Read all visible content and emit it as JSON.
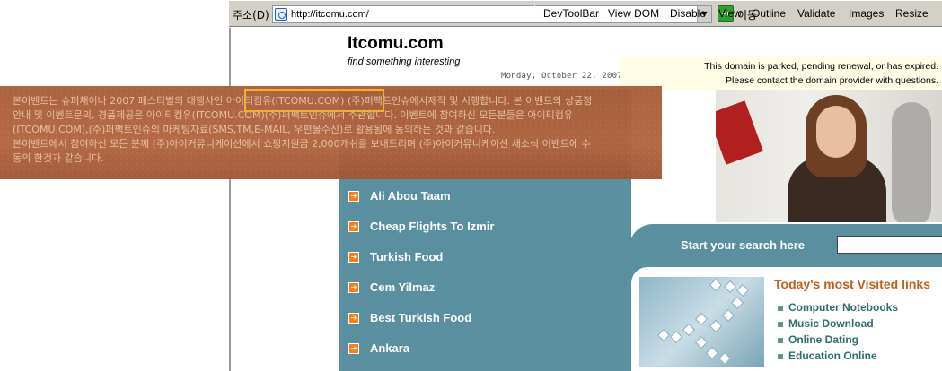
{
  "browser": {
    "address_label": "주소(D)",
    "url": "http://itcomu.com/",
    "go_label": "이동",
    "toolbar": [
      "DevToolBar",
      "View DOM",
      "Disable",
      "View",
      "Outline",
      "Validate",
      "Images",
      "Resize"
    ]
  },
  "site": {
    "title": "Itcomu.com",
    "tagline": "find something interesting",
    "date": "Monday, October 22, 2007"
  },
  "notice": {
    "line1": "This domain is parked, pending renewal, or has expired.",
    "line2": "Please contact the domain provider with questions."
  },
  "overlay": {
    "lines": [
      "본이벤트는 슈퍼채이나 2007 페스티벌의 대행사인 아이티컴유(ITCOMU.COM) (주)퍼팩트인슈에서제작 및 시행합니다. 본 이벤트의 상품정",
      "안내 및 이벤트문의, 경품제공은 아이티컴유(ITCOMU.COM)(주)퍼팩트인슈에서 주관합니다. 이벤트에 참여하신 모든분들은 아이티컴유",
      "(ITCOMU.COM),(주)퍼팩트인슈의 마케팅자료(SMS,TM,E-MAIL, 우편물수신)로 활용됨에 동의하는 것과 같습니다.",
      "본이벤트에서 참여하신 모든 분께 (주)아이커뮤니케이션에서 쇼핑지원금 2,000캐쉬를 보내드리며 (주)아이커뮤니케이션 새소식 이벤트에 수",
      "동의 한것과 같습니다."
    ]
  },
  "links": [
    "Ali Abou Taam",
    "Cheap Flights To Izmir",
    "Turkish Food",
    "Cem Yilmaz",
    "Best Turkish Food",
    "Ankara"
  ],
  "search": {
    "label": "Start your search here",
    "value": ""
  },
  "visited": {
    "title": "Today's most Visited links",
    "items": [
      "Computer Notebooks",
      "Music Download",
      "Online Dating",
      "Education Online"
    ]
  }
}
